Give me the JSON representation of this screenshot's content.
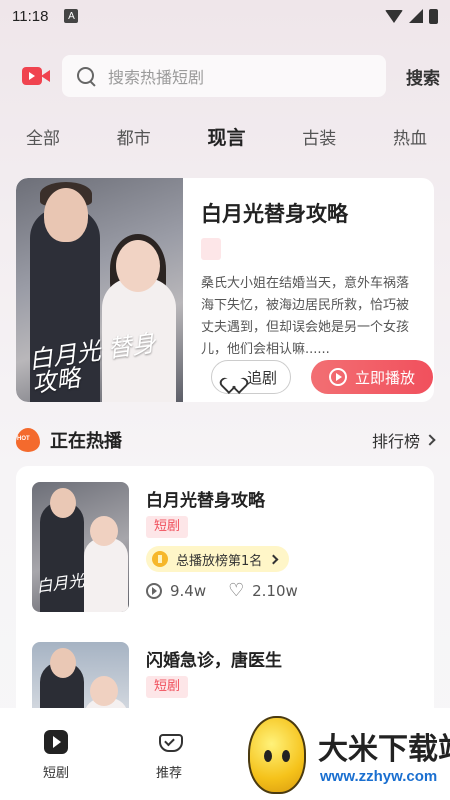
{
  "status_bar": {
    "time": "11:18",
    "badge": "A"
  },
  "search": {
    "placeholder": "搜索热播短剧",
    "button_label": "搜索"
  },
  "tabs": [
    {
      "label": "全部"
    },
    {
      "label": "都市"
    },
    {
      "label": "现言",
      "active": true
    },
    {
      "label": "古装"
    },
    {
      "label": "热血"
    }
  ],
  "featured": {
    "poster_title": "白月光 替身攻略",
    "title": "白月光替身攻略",
    "description": "桑氏大小姐在结婚当天，意外车祸落海下失忆，被海边居民所救，恰巧被丈夫遇到，但却误会她是另一个女孩儿，他们会相认嘛......",
    "follow_label": "追剧",
    "play_label": "立即播放"
  },
  "section": {
    "hot_badge": "HOT",
    "title": "正在热播",
    "more_label": "排行榜"
  },
  "list": [
    {
      "title": "白月光替身攻略",
      "tag": "短剧",
      "rank": "总播放榜第1名",
      "plays": "9.4w",
      "likes": "2.10w",
      "poster_text": "白月光"
    },
    {
      "title": "闪婚急诊，唐医生",
      "tag": "短剧"
    }
  ],
  "bottom_nav": [
    {
      "label": "短剧",
      "icon": "play-icon"
    },
    {
      "label": "推荐",
      "icon": "recommend-icon"
    }
  ],
  "watermark": {
    "title": "大米下载站",
    "url": "www.zzhyw.com"
  },
  "colors": {
    "accent": "#f0505c",
    "tag_bg": "#fde6e8",
    "rank_bg": "#fff6c8"
  }
}
